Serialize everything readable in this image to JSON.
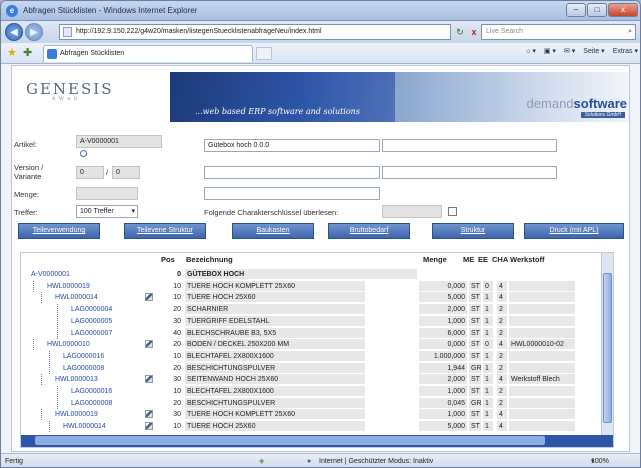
{
  "window": {
    "title": "Abfragen Stücklisten - Windows Internet Explorer",
    "btn_min": "–",
    "btn_max": "□",
    "btn_close": "x"
  },
  "addressbar": {
    "url": "http://192.9.150.222/g4w20/masken/listegenStuecklistenabfrageNeu/index.html",
    "search_placeholder": "Live Search",
    "back": "◀",
    "forward": "▶",
    "refresh": "↻",
    "stop": "x",
    "go": "⚡",
    "search_icon": "⌕"
  },
  "favorites": {
    "tab_label": "Abfragen Stücklisten",
    "tools": [
      "Seite ▾",
      "Extras ▾"
    ],
    "toolbar_glyphs": [
      "⌂ ▾",
      "▣ ▾",
      "✉ ▾"
    ]
  },
  "header": {
    "logo": "GENESIS",
    "logo_sub": "4 W e b",
    "slogan": "...web based ERP software and solutions",
    "brand_light": "demand",
    "brand_bold": "software",
    "brand_sub": "Solutions GmbH"
  },
  "form": {
    "artikel_label": "Artikel:",
    "artikel_value": "A-V0000001",
    "artikel_desc": "Gütebox hoch 0.0.0",
    "version_label": "Version /",
    "variante_label": "Variante",
    "version_value": "0",
    "variante_value": "0",
    "slash": "/",
    "menge_label": "Menge:",
    "treffer_label": "Treffer:",
    "treffer_value": "100 Treffer",
    "charakter_label": "Folgende Charakterschlüssel überlesen:"
  },
  "buttons": [
    "Teileverwendung",
    "Teilevene Struktur",
    "Baukasten",
    "Bruttobedarf",
    "Struktur",
    "Druck (mit APL)"
  ],
  "table": {
    "headers": {
      "pos": "Pos",
      "bez": "Bezeichnung",
      "menge": "Menge",
      "me": "ME",
      "ee": "EE",
      "cha": "CHA",
      "werkstoff": "Werkstoff"
    },
    "rows": [
      {
        "nr": "A-V0000001",
        "pos": "0",
        "bez": "GÜTEBOX HOCH",
        "menge": "",
        "me": "",
        "ee": "",
        "cha": "",
        "werkstoff": ""
      },
      {
        "nr": "HWL0000019",
        "pos": "10",
        "bez": "TUERE HOCH KOMPLETT 25X60",
        "menge": "0,000",
        "me": "ST",
        "ee": "0",
        "cha": "4",
        "werkstoff": ""
      },
      {
        "nr": "HWL0000014",
        "pos": "10",
        "bez": "TUERE HOCH 25X60",
        "menge": "5,000",
        "me": "ST",
        "ee": "1",
        "cha": "4",
        "werkstoff": ""
      },
      {
        "nr": "LAG0000004",
        "pos": "20",
        "bez": "SCHARNIER",
        "menge": "2,000",
        "me": "ST",
        "ee": "1",
        "cha": "2",
        "werkstoff": ""
      },
      {
        "nr": "LAG0000005",
        "pos": "30",
        "bez": "TUERGRIFF EDELSTAHL",
        "menge": "1,000",
        "me": "ST",
        "ee": "1",
        "cha": "2",
        "werkstoff": ""
      },
      {
        "nr": "LAG0000007",
        "pos": "40",
        "bez": "BLECHSCHRAUBE B3, 5X5",
        "menge": "6,000",
        "me": "ST",
        "ee": "1",
        "cha": "2",
        "werkstoff": ""
      },
      {
        "nr": "HWL0000010",
        "pos": "20",
        "bez": "BODEN / DECKEL 250X200 MM",
        "menge": "0,000",
        "me": "ST",
        "ee": "0",
        "cha": "4",
        "werkstoff": "HWL0000010-02"
      },
      {
        "nr": "LAG0000016",
        "pos": "10",
        "bez": "BLECHTAFEL 2X800X1600",
        "menge": "1.000,000",
        "me": "ST",
        "ee": "1",
        "cha": "2",
        "werkstoff": ""
      },
      {
        "nr": "LAG0000008",
        "pos": "20",
        "bez": "BESCHICHTUNGSPULVER",
        "menge": "1,944",
        "me": "GR",
        "ee": "1",
        "cha": "2",
        "werkstoff": ""
      },
      {
        "nr": "HWL0000013",
        "pos": "30",
        "bez": "SEITENWAND HOCH 25X60",
        "menge": "2,000",
        "me": "ST",
        "ee": "1",
        "cha": "4",
        "werkstoff": "Werkstoff Blech"
      },
      {
        "nr": "LAG0000016",
        "pos": "10",
        "bez": "BLECHTAFEL 2X800X1600",
        "menge": "1,000",
        "me": "ST",
        "ee": "1",
        "cha": "2",
        "werkstoff": ""
      },
      {
        "nr": "LAG0000008",
        "pos": "20",
        "bez": "BESCHICHTUNGSPULVER",
        "menge": "0,045",
        "me": "GR",
        "ee": "1",
        "cha": "2",
        "werkstoff": ""
      },
      {
        "nr": "HWL0000019",
        "pos": "30",
        "bez": "TUERE HOCH KOMPLETT 25X60",
        "menge": "1,000",
        "me": "ST",
        "ee": "1",
        "cha": "4",
        "werkstoff": ""
      },
      {
        "nr": "HWL0000014",
        "pos": "10",
        "bez": "TUERE HOCH 25X60",
        "menge": "5,000",
        "me": "ST",
        "ee": "1",
        "cha": "4",
        "werkstoff": ""
      }
    ]
  },
  "statusbar": {
    "left": "Fertig",
    "zone": "Internet | Geschützter Modus: Inaktiv",
    "zoom": "100%",
    "zoom_arrow": "▾"
  }
}
